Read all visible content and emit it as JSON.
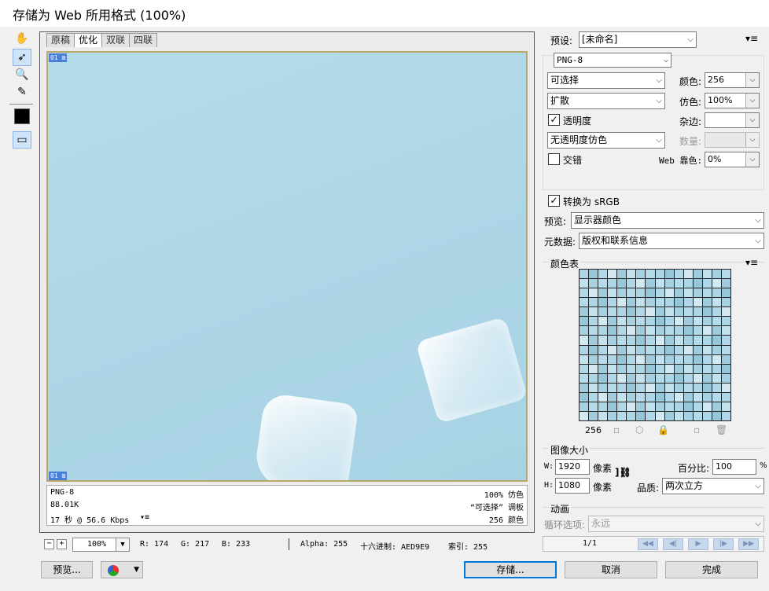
{
  "window": {
    "title": "存储为 Web 所用格式 (100%)"
  },
  "tabs": [
    "原稿",
    "优化",
    "双联",
    "四联"
  ],
  "slices": {
    "top": "01",
    "bottom": "01"
  },
  "info": {
    "format": "PNG-8",
    "size": "88.01K",
    "time": "17 秒 @ 56.6 Kbps",
    "dither": "100% 仿色",
    "palette": "“可选择” 调板",
    "colors": "256 颜色"
  },
  "status": {
    "zoom": "100%",
    "r": "R: 174",
    "g": "G: 217",
    "b": "B: 233",
    "alpha": "Alpha: 255",
    "hex": "十六进制: AED9E9",
    "index": "索引: 255"
  },
  "buttons": {
    "preview": "预览...",
    "save": "存储...",
    "cancel": "取消",
    "done": "完成"
  },
  "settings": {
    "preset_label": "预设:",
    "preset_value": "[未命名]",
    "format": "PNG-8",
    "reduction": "可选择",
    "dither_algo": "扩散",
    "transparency_label": "透明度",
    "transparency_dither": "无透明度仿色",
    "interlaced_label": "交错",
    "colors_label": "颜色:",
    "colors_value": "256",
    "dither_label": "仿色:",
    "dither_value": "100%",
    "matte_label": "杂边:",
    "amount_label": "数量:",
    "web_snap_label": "Web 靠色:",
    "web_snap_value": "0%",
    "convert_srgb": "转换为 sRGB",
    "preview_label": "预览:",
    "preview_value": "显示器颜色",
    "metadata_label": "元数据:",
    "metadata_value": "版权和联系信息"
  },
  "color_table": {
    "title": "颜色表",
    "count": "256"
  },
  "image_size": {
    "title": "图像大小",
    "w_label": "W:",
    "w_value": "1920",
    "h_label": "H:",
    "h_value": "1080",
    "unit": "像素",
    "percent_label": "百分比:",
    "percent_value": "100",
    "percent_unit": "%",
    "quality_label": "品质:",
    "quality_value": "两次立方"
  },
  "animation": {
    "title": "动画",
    "loop_label": "循环选项:",
    "loop_value": "永远",
    "frame": "1/1"
  },
  "colors": {
    "accent": "#0078d7",
    "image_blue": "#AED9E9"
  }
}
